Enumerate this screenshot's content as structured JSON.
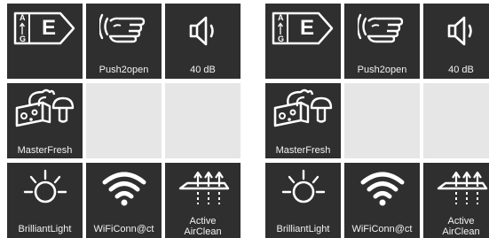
{
  "panels": [
    {
      "energy_class": {
        "letter": "E",
        "scale_top": "A",
        "scale_bottom": "G"
      },
      "tiles": {
        "push2open": {
          "label": "Push2open",
          "icon": "hand-push-icon"
        },
        "noise": {
          "label": "40 dB",
          "icon": "speaker-icon"
        },
        "masterfresh": {
          "label": "MasterFresh",
          "icon": "masterfresh-icon"
        },
        "brilliantlight": {
          "label": "BrilliantLight",
          "icon": "light-icon"
        },
        "wifi": {
          "label": "WiFiConn@ct",
          "icon": "wifi-icon"
        },
        "airclean": {
          "label_line1": "Active",
          "label_line2": "AirClean",
          "icon": "airclean-icon"
        }
      }
    },
    {
      "energy_class": {
        "letter": "E",
        "scale_top": "A",
        "scale_bottom": "G"
      },
      "tiles": {
        "push2open": {
          "label": "Push2open",
          "icon": "hand-push-icon"
        },
        "noise": {
          "label": "40 dB",
          "icon": "speaker-icon"
        },
        "masterfresh": {
          "label": "MasterFresh",
          "icon": "masterfresh-icon"
        },
        "brilliantlight": {
          "label": "BrilliantLight",
          "icon": "light-icon"
        },
        "wifi": {
          "label": "WiFiConn@ct",
          "icon": "wifi-icon"
        },
        "airclean": {
          "label_line1": "Active",
          "label_line2": "AirClean",
          "icon": "airclean-icon"
        }
      }
    }
  ],
  "colors": {
    "tile_dark": "#2f2f2f",
    "tile_empty": "#e6e6e6",
    "icon": "#ffffff"
  }
}
